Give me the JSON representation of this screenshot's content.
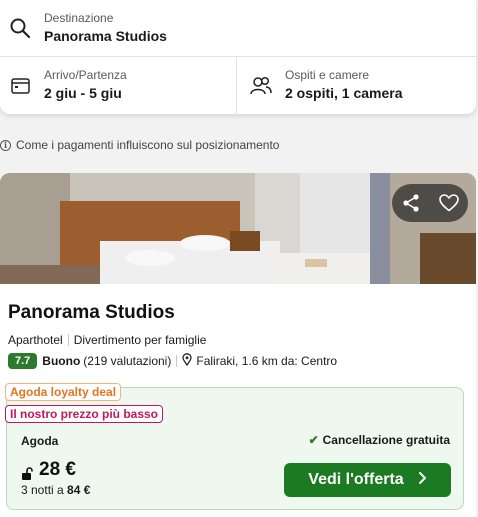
{
  "search": {
    "destination_label": "Destinazione",
    "destination_value": "Panorama Studios",
    "dates_label": "Arrivo/Partenza",
    "dates_value": "2 giu - 5 giu",
    "guests_label": "Ospiti e camere",
    "guests_value": "2 ospiti, 1 camera"
  },
  "info_note": "Come i pagamenti influiscono sul posizionamento",
  "hotel": {
    "name": "Panorama Studios",
    "type": "Aparthotel",
    "tag": "Divertimento per famiglie",
    "score": "7.7",
    "rating_word": "Buono",
    "reviews": "(219 valutazioni)",
    "location": "Faliraki, 1.6 km da: Centro",
    "actions": {
      "share_icon": "share-icon",
      "favorite_icon": "heart-icon"
    }
  },
  "deal": {
    "loyalty_badge": "Agoda loyalty deal",
    "lowest_price_badge": "Il nostro prezzo più basso",
    "provider": "Agoda",
    "cancellation": "Cancellazione gratuita",
    "price": "28 €",
    "nights_text": "3 notti a",
    "total": "84 €",
    "cta_label": "Vedi l'offerta"
  },
  "colors": {
    "score_green": "#2d7a2d",
    "cta_green": "#1c7a22",
    "deal_bg": "#eef8ee",
    "loyalty_orange": "#e0761d",
    "price_badge_pink": "#c2185b"
  }
}
